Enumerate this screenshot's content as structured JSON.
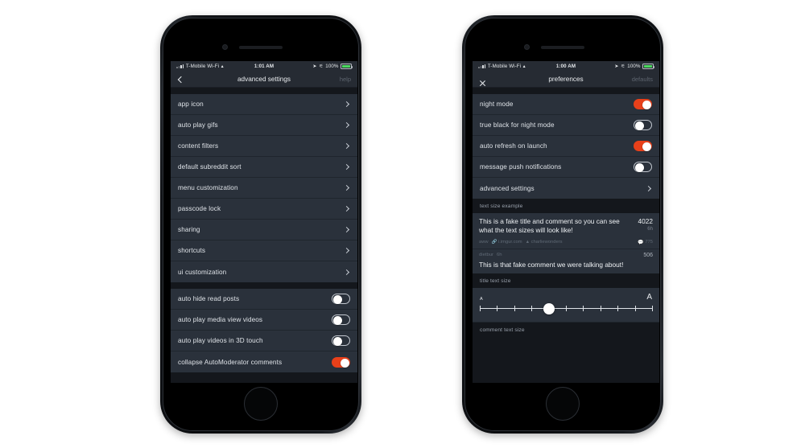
{
  "scene": {
    "background": "#ffffff",
    "accent": "#e8401a",
    "row_bg": "#2a313b",
    "screen_bg": "#14171c"
  },
  "phone_left": {
    "status_bar": {
      "carrier": "T-Mobile Wi-Fi",
      "wifi_icon": "wifi-icon",
      "time": "1:01 AM",
      "location_icon": "location-arrow-icon",
      "bluetooth_icon": "bluetooth-icon",
      "battery_percent": "100%",
      "battery_icon": "battery-full-icon"
    },
    "nav": {
      "back_icon": "chevron-left-icon",
      "title": "advanced settings",
      "action": "help"
    },
    "group_one": [
      {
        "label": "app icon",
        "type": "disclosure"
      },
      {
        "label": "auto play gifs",
        "type": "disclosure"
      },
      {
        "label": "content filters",
        "type": "disclosure"
      },
      {
        "label": "default subreddit sort",
        "type": "disclosure"
      },
      {
        "label": "menu customization",
        "type": "disclosure"
      },
      {
        "label": "passcode lock",
        "type": "disclosure"
      },
      {
        "label": "sharing",
        "type": "disclosure"
      },
      {
        "label": "shortcuts",
        "type": "disclosure"
      },
      {
        "label": "ui customization",
        "type": "disclosure"
      }
    ],
    "group_two": [
      {
        "label": "auto hide read posts",
        "type": "toggle",
        "on": false
      },
      {
        "label": "auto play media view videos",
        "type": "toggle",
        "on": false
      },
      {
        "label": "auto play videos in 3D touch",
        "type": "toggle",
        "on": false
      },
      {
        "label": "collapse AutoModerator comments",
        "type": "toggle",
        "on": true
      }
    ]
  },
  "phone_right": {
    "status_bar": {
      "carrier": "T-Mobile Wi-Fi",
      "wifi_icon": "wifi-icon",
      "time": "1:00 AM",
      "location_icon": "location-arrow-icon",
      "bluetooth_icon": "bluetooth-icon",
      "battery_percent": "100%",
      "battery_icon": "battery-full-icon"
    },
    "nav": {
      "close_icon": "close-x-icon",
      "title": "preferences",
      "action": "defaults"
    },
    "group_one": [
      {
        "label": "night mode",
        "type": "toggle",
        "on": true
      },
      {
        "label": "true black for night mode",
        "type": "toggle",
        "on": false
      },
      {
        "label": "auto refresh on launch",
        "type": "toggle",
        "on": true
      },
      {
        "label": "message push notifications",
        "type": "toggle",
        "on": false
      },
      {
        "label": "advanced settings",
        "type": "disclosure"
      }
    ],
    "text_size_example": {
      "section_header": "text size example",
      "post": {
        "title": "This is a fake title and comment so you can see what the text sizes will look like!",
        "score": "4022",
        "age": "6h",
        "subreddit": "aww",
        "domain": "i.imgur.com",
        "author": "charliewonders",
        "comment_count": "775",
        "link_icon": "link-icon",
        "person_icon": "person-icon",
        "comment_icon": "comment-bubble-icon"
      },
      "comment": {
        "author": "dietbur",
        "age": "6h",
        "points": "506",
        "body": "This is that fake comment we were talking about!"
      }
    },
    "title_text_size": {
      "section_header": "title text size",
      "small_a": "A",
      "large_a": "A",
      "ticks": 11,
      "value": 4
    },
    "comment_text_size": {
      "section_header": "comment text size"
    }
  }
}
